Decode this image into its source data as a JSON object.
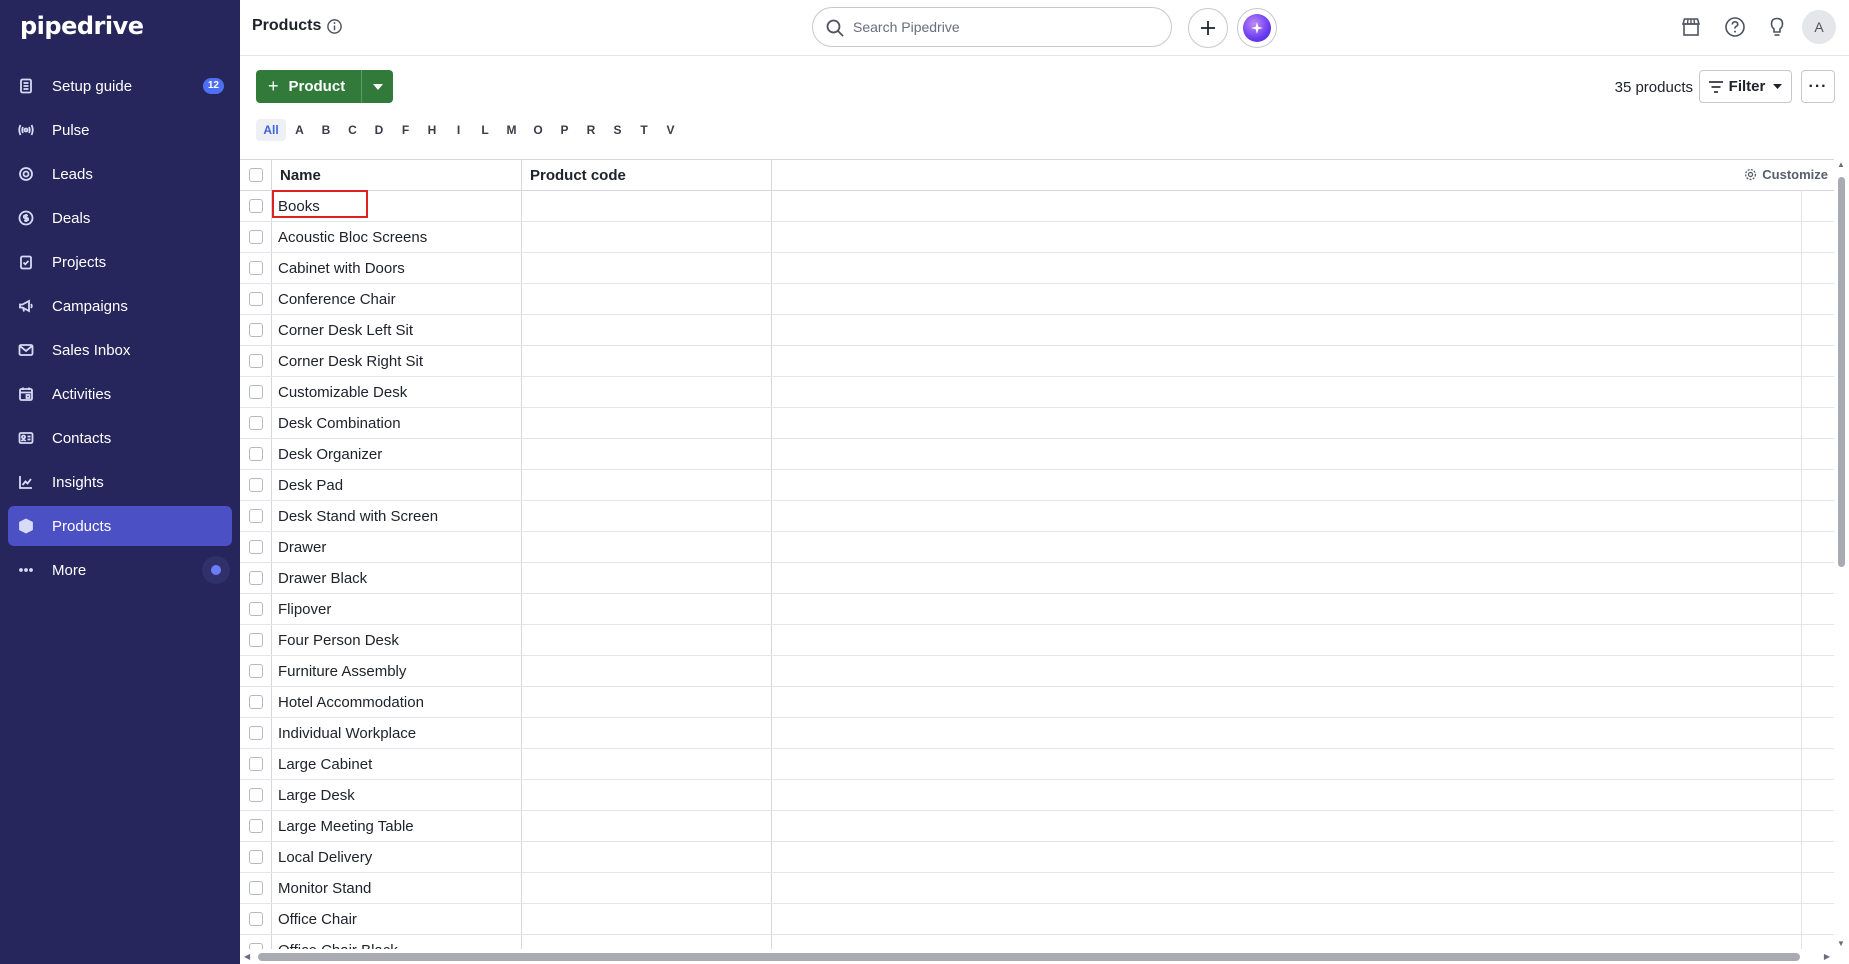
{
  "app": {
    "logo_text": "pipedrive"
  },
  "sidebar": {
    "items": [
      {
        "label": "Setup guide",
        "icon": "checklist-icon",
        "badge": "12"
      },
      {
        "label": "Pulse",
        "icon": "pulse-icon"
      },
      {
        "label": "Leads",
        "icon": "target-icon"
      },
      {
        "label": "Deals",
        "icon": "dollar-icon"
      },
      {
        "label": "Projects",
        "icon": "clipboard-icon"
      },
      {
        "label": "Campaigns",
        "icon": "megaphone-icon"
      },
      {
        "label": "Sales Inbox",
        "icon": "mail-icon"
      },
      {
        "label": "Activities",
        "icon": "calendar-icon"
      },
      {
        "label": "Contacts",
        "icon": "contact-card-icon"
      },
      {
        "label": "Insights",
        "icon": "chart-icon"
      },
      {
        "label": "Products",
        "icon": "box-icon",
        "active": true
      },
      {
        "label": "More",
        "icon": "ellipsis-icon"
      }
    ]
  },
  "header": {
    "title": "Products",
    "search_placeholder": "Search Pipedrive",
    "avatar_initial": "A"
  },
  "toolbar": {
    "add_label": "Product",
    "count_text": "35 products",
    "filter_label": "Filter",
    "more_label": "···"
  },
  "alphabet": [
    "All",
    "A",
    "B",
    "C",
    "D",
    "F",
    "H",
    "I",
    "L",
    "M",
    "O",
    "P",
    "R",
    "S",
    "T",
    "V"
  ],
  "table": {
    "columns": {
      "name": "Name",
      "code": "Product code",
      "customize": "Customize"
    },
    "rows": [
      "Books",
      "Acoustic Bloc Screens",
      "Cabinet with Doors",
      "Conference Chair",
      "Corner Desk Left Sit",
      "Corner Desk Right Sit",
      "Customizable Desk",
      "Desk Combination",
      "Desk Organizer",
      "Desk Pad",
      "Desk Stand with Screen",
      "Drawer",
      "Drawer Black",
      "Flipover",
      "Four Person Desk",
      "Furniture Assembly",
      "Hotel Accommodation",
      "Individual Workplace",
      "Large Cabinet",
      "Large Desk",
      "Large Meeting Table",
      "Local Delivery",
      "Monitor Stand",
      "Office Chair",
      "Office Chair Black"
    ]
  },
  "colors": {
    "sidebar_bg": "#26265c",
    "active_nav": "#4c50c5",
    "primary_green": "#317a39",
    "highlight_red": "#e02020"
  }
}
